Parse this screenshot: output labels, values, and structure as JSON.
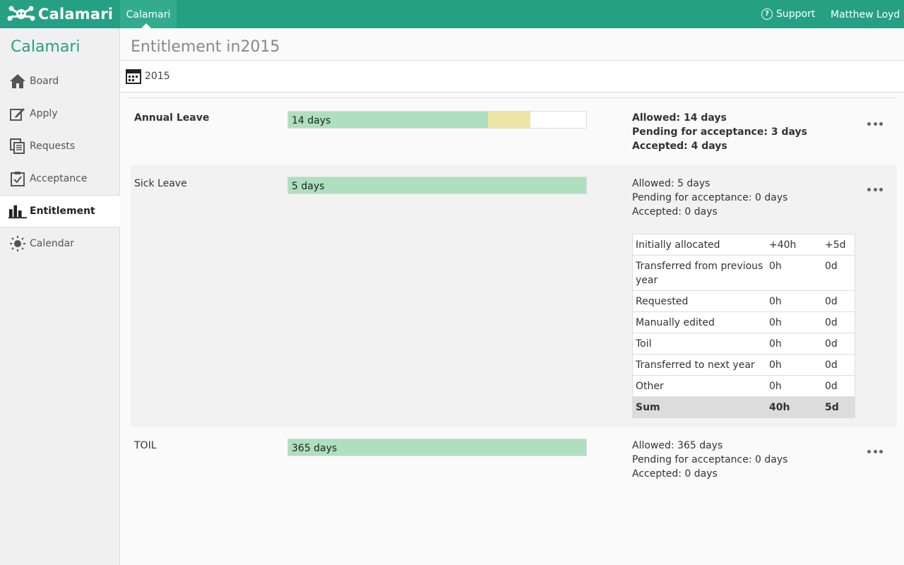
{
  "header": {
    "logo_text": "Calamari",
    "nav_item": "Calamari",
    "support_label": "Support",
    "user_name": "Matthew Loyd",
    "accent": "#26a083"
  },
  "sidebar": {
    "brand": "Calamari",
    "items": [
      {
        "label": "Board",
        "icon": "home-icon",
        "active": false
      },
      {
        "label": "Apply",
        "icon": "edit-icon",
        "active": false
      },
      {
        "label": "Requests",
        "icon": "list-icon",
        "active": false
      },
      {
        "label": "Acceptance",
        "icon": "clipboard-check-icon",
        "active": false
      },
      {
        "label": "Entitlement",
        "icon": "bar-chart-icon",
        "active": true
      },
      {
        "label": "Calendar",
        "icon": "sun-icon",
        "active": false
      }
    ]
  },
  "page": {
    "title": "Entitlement in2015",
    "year": "2015"
  },
  "entitlements": [
    {
      "name": "Annual Leave",
      "bar_label": "14 days",
      "accepted_fraction": 0.67,
      "pending_fraction": 0.143,
      "allowed": "Allowed: 14 days",
      "pending": "Pending for acceptance: 3 days",
      "accepted": "Accepted: 4 days"
    },
    {
      "name": "Sick Leave",
      "bar_label": "5 days",
      "accepted_fraction": 1.0,
      "pending_fraction": 0,
      "allowed": "Allowed: 5 days",
      "pending": "Pending for acceptance: 0 days",
      "accepted": "Accepted: 0 days",
      "details": [
        {
          "label": "Initially allocated",
          "hours": "+40h",
          "days": "+5d"
        },
        {
          "label": "Transferred from previous year",
          "hours": "0h",
          "days": "0d"
        },
        {
          "label": "Requested",
          "hours": "0h",
          "days": "0d"
        },
        {
          "label": "Manually edited",
          "hours": "0h",
          "days": "0d"
        },
        {
          "label": "Toil",
          "hours": "0h",
          "days": "0d"
        },
        {
          "label": "Transferred to next year",
          "hours": "0h",
          "days": "0d"
        },
        {
          "label": "Other",
          "hours": "0h",
          "days": "0d"
        },
        {
          "label": "Sum",
          "hours": "40h",
          "days": "5d"
        }
      ]
    },
    {
      "name": "TOIL",
      "bar_label": "365 days",
      "accepted_fraction": 1.0,
      "pending_fraction": 0,
      "allowed": "Allowed: 365 days",
      "pending": "Pending for acceptance: 0 days",
      "accepted": "Accepted: 0 days"
    }
  ]
}
